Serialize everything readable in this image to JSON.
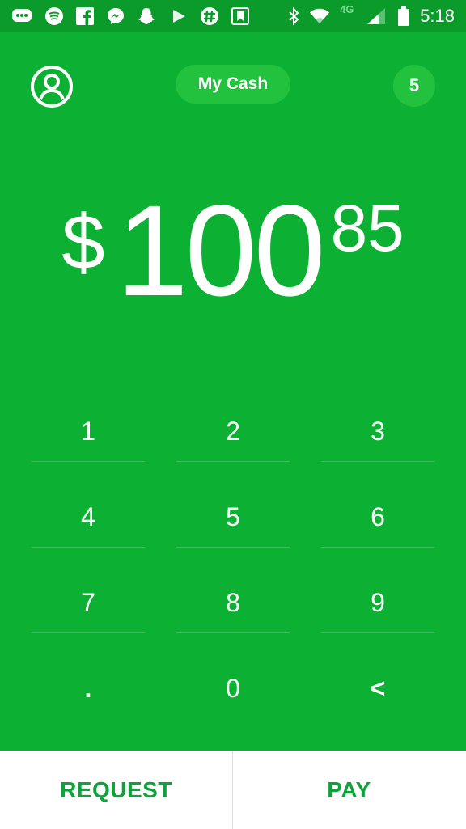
{
  "status_bar": {
    "time": "5:18",
    "network": "4G",
    "icons": [
      "messages-icon",
      "spotify-icon",
      "facebook-icon",
      "messenger-icon",
      "snapchat-icon",
      "play-store-icon",
      "slack-icon",
      "bookmark-app-icon",
      "bluetooth-icon",
      "wifi-icon",
      "signal-icon",
      "battery-icon"
    ]
  },
  "header": {
    "title": "My Cash",
    "notification_count": "5"
  },
  "amount": {
    "currency": "$",
    "whole": "100",
    "cents": "85"
  },
  "keypad": {
    "keys": [
      "1",
      "2",
      "3",
      "4",
      "5",
      "6",
      "7",
      "8",
      "9",
      ".",
      "0",
      "<"
    ]
  },
  "actions": {
    "request_label": "REQUEST",
    "pay_label": "PAY"
  },
  "colors": {
    "background": "#0cb032",
    "status_bar": "#0a9b2b",
    "pill": "#22c23f",
    "action_text": "#0ca33a"
  }
}
